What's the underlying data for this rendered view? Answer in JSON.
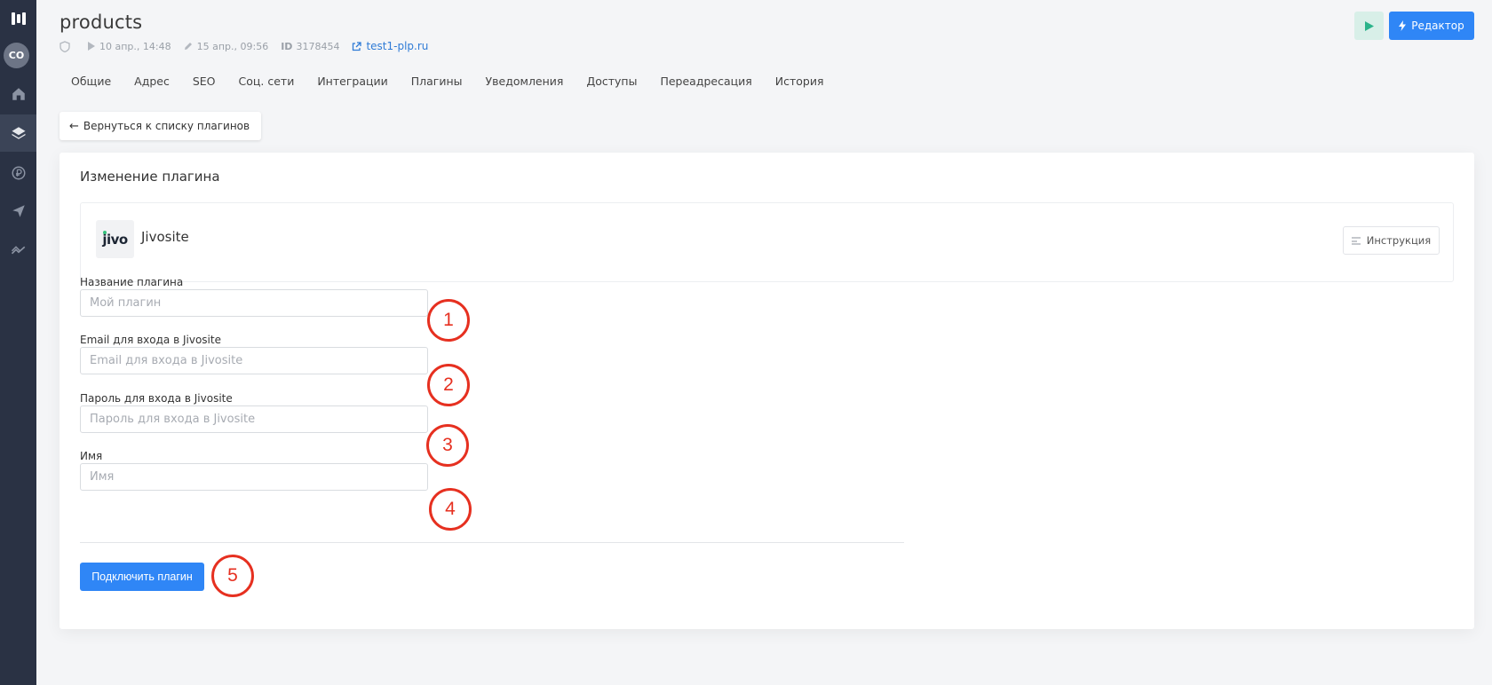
{
  "sidebar": {
    "avatar_initials": "CO",
    "items": [
      {
        "icon": "home-icon"
      },
      {
        "icon": "layers-icon",
        "active": true
      },
      {
        "icon": "ruble-icon"
      },
      {
        "icon": "send-icon"
      },
      {
        "icon": "trending-icon"
      }
    ]
  },
  "header": {
    "title": "products",
    "published": "10 апр., 14:48",
    "edited": "15 апр., 09:56",
    "id_label": "ID",
    "id_value": "3178454",
    "site_link": "test1-plp.ru",
    "editor_button": "Редактор"
  },
  "tabs": [
    "Общие",
    "Адрес",
    "SEO",
    "Соц. сети",
    "Интеграции",
    "Плагины",
    "Уведомления",
    "Доступы",
    "Переадресация",
    "История"
  ],
  "back_button": "Вернуться к списку плагинов",
  "card": {
    "title": "Изменение плагина",
    "plugin_logo_text": "jivo",
    "plugin_name": "Jivosite",
    "instruction_button": "Инструкция",
    "fields": [
      {
        "label": "Название плагина",
        "placeholder": "Мой плагин"
      },
      {
        "label": "Email для входа в Jivosite",
        "placeholder": "Email для входа в Jivosite"
      },
      {
        "label": "Пароль для входа в Jivosite",
        "placeholder": "Пароль для входа в Jivosite"
      },
      {
        "label": "Имя",
        "placeholder": "Имя"
      }
    ],
    "submit_button": "Подключить плагин"
  },
  "annotations": [
    "1",
    "2",
    "3",
    "4",
    "5"
  ],
  "colors": {
    "sidebar": "#2a3244",
    "primary": "#2f86f6",
    "annotation": "#e63020",
    "play_bg": "#d8efe8",
    "play_icon": "#2bb38a"
  }
}
